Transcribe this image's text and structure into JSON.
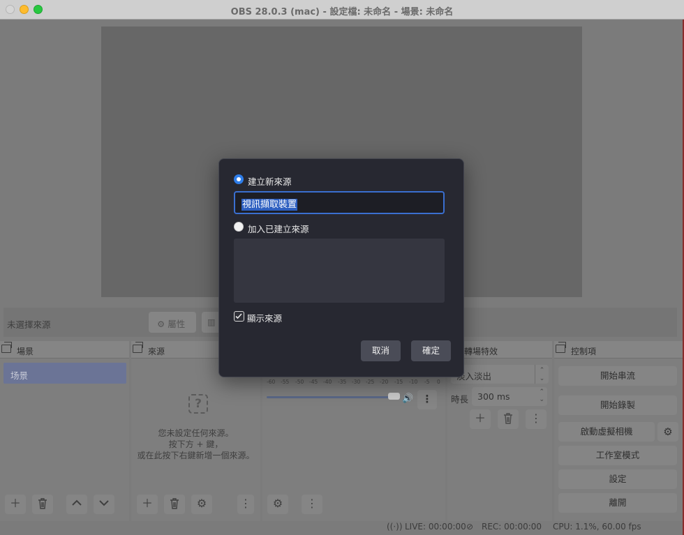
{
  "window": {
    "title": "OBS 28.0.3 (mac) - 設定檔: 未命名 - 場景: 未命名"
  },
  "context_bar": {
    "no_source_label": "未選擇來源",
    "properties_label": "屬性"
  },
  "scenes": {
    "title": "場景",
    "items": [
      "场景"
    ]
  },
  "sources": {
    "title": "來源",
    "empty_line1": "您未設定任何來源。",
    "empty_line2": "按下方 + 鍵，",
    "empty_line3": "或在此按下右鍵新增一個來源。"
  },
  "mixer": {
    "ticks": [
      "-60",
      "-55",
      "-50",
      "-45",
      "-40",
      "-35",
      "-30",
      "-25",
      "-20",
      "-15",
      "-10",
      "-5",
      "0"
    ],
    "volume_level": 0.95
  },
  "transitions": {
    "title": "轉場特效",
    "selected": "淡入淡出",
    "duration_label": "時長",
    "duration_value": "300 ms"
  },
  "controls": {
    "title": "控制項",
    "start_streaming": "開始串流",
    "start_recording": "開始錄製",
    "start_virtual_camera": "啟動虛擬相機",
    "studio_mode": "工作室模式",
    "settings": "設定",
    "exit": "離開"
  },
  "status": {
    "live": "LIVE: 00:00:00",
    "rec": "REC: 00:00:00",
    "cpu": "CPU: 1.1%, 60.00 fps"
  },
  "dialog": {
    "create_new_label": "建立新來源",
    "create_new_selected": true,
    "name_value": "視訊擷取裝置",
    "add_existing_label": "加入已建立來源",
    "add_existing_selected": false,
    "visible_label": "顯示來源",
    "visible_checked": true,
    "cancel_label": "取消",
    "ok_label": "確定"
  },
  "colors": {
    "accent": "#2e7de9",
    "dialog_bg": "#272831",
    "scene_selected": "#6b7496"
  }
}
